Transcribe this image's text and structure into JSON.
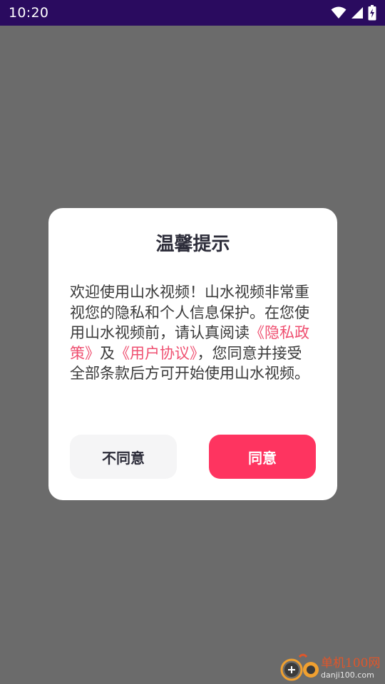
{
  "status_bar": {
    "time": "10:20",
    "icons": [
      "wifi-icon",
      "signal-icon",
      "battery-charging-icon"
    ]
  },
  "dialog": {
    "title": "温馨提示",
    "body": {
      "text_1": "欢迎使用山水视频！山水视频非常重视您的隐私和个人信息保护。在您使用山水视频前，请认真阅读",
      "privacy_link": "《隐私政策》",
      "text_2": "及",
      "agreement_link": "《用户协议》",
      "text_3": "，您同意并接受全部条款后方可开始使用山水视频。"
    },
    "disagree_label": "不同意",
    "agree_label": "同意"
  },
  "watermark": {
    "title": "单机100网",
    "subtitle": "danji100.com"
  },
  "colors": {
    "status_bar": "#2a0b5f",
    "overlay": "#6b6b6b",
    "agree_button": "#fe3460",
    "disagree_button": "#f5f5f6",
    "link": "#ef4f70"
  }
}
